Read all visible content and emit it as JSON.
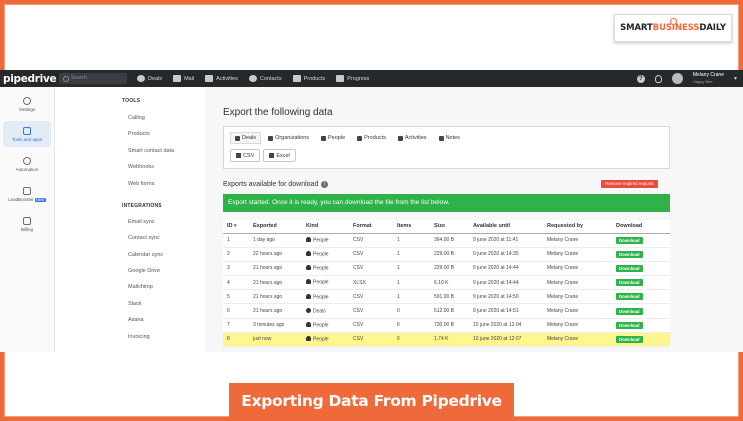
{
  "brand": {
    "smart": "SMART",
    "business": "BUSINESS",
    "daily": "DAILY"
  },
  "caption": "Exporting Data From Pipedrive",
  "topbar": {
    "logo": "pipedrive",
    "search_placeholder": "Search",
    "nav": [
      {
        "label": "Deals",
        "icon": "dollar-icon"
      },
      {
        "label": "Mail",
        "icon": "mail-icon"
      },
      {
        "label": "Activities",
        "icon": "calendar-icon"
      },
      {
        "label": "Contacts",
        "icon": "person-icon"
      },
      {
        "label": "Products",
        "icon": "box-icon"
      },
      {
        "label": "Progress",
        "icon": "trend-icon"
      }
    ],
    "user_name": "Melany Crane",
    "user_company": "Happy Bee"
  },
  "leftnav": [
    {
      "label": "Settings",
      "icon": "gear-icon"
    },
    {
      "label": "Tools and apps",
      "icon": "tools-icon",
      "active": true
    },
    {
      "label": "Automation",
      "icon": "automation-icon"
    },
    {
      "label": "LeadBooster",
      "badge": "NEW",
      "icon": "chat-icon"
    },
    {
      "label": "Billing",
      "icon": "billing-icon"
    }
  ],
  "sidenav": {
    "tools_title": "TOOLS",
    "tools": [
      "Calling",
      "Products",
      "Smart contact data",
      "Webhooks",
      "Web forms"
    ],
    "integrations_title": "INTEGRATIONS",
    "integrations": [
      "Email sync",
      "Contact sync",
      "Calendar sync",
      "Google Drive",
      "Mailchimp",
      "Slack",
      "Asana",
      "Invoicing"
    ]
  },
  "main": {
    "title": "Export the following data",
    "tabs": [
      "Deals",
      "Organizations",
      "People",
      "Products",
      "Activities",
      "Notes"
    ],
    "formats": [
      "CSV",
      "Excel"
    ],
    "exports_title": "Exports available for download",
    "remove_label": "Remove expired exports",
    "banner": "Export started. Once it is ready, you can download the file from the list below.",
    "columns": [
      "ID",
      "Exported",
      "Kind",
      "Format",
      "Items",
      "Size",
      "Available until",
      "Requested by",
      "Download"
    ],
    "rows": [
      {
        "id": "1",
        "exported": "1 day ago",
        "kind": "People",
        "format": "CSV",
        "items": "1",
        "size": "364.00 B",
        "until": "9 june 2020 at 11:41",
        "by": "Melany Crane",
        "dl": "Download"
      },
      {
        "id": "2",
        "exported": "22 hours ago",
        "kind": "People",
        "format": "CSV",
        "items": "1",
        "size": "229.00 B",
        "until": "9 june 2020 at 14:35",
        "by": "Melany Crane",
        "dl": "Download"
      },
      {
        "id": "3",
        "exported": "21 hours ago",
        "kind": "People",
        "format": "CSV",
        "items": "1",
        "size": "229.00 B",
        "until": "9 june 2020 at 14:44",
        "by": "Melany Crane",
        "dl": "Download"
      },
      {
        "id": "4",
        "exported": "21 hours ago",
        "kind": "People",
        "format": "XLSX",
        "items": "1",
        "size": "6.10 K",
        "until": "9 june 2020 at 14:44",
        "by": "Melany Crane",
        "dl": "Download"
      },
      {
        "id": "5",
        "exported": "21 hours ago",
        "kind": "People",
        "format": "CSV",
        "items": "1",
        "size": "591.00 B",
        "until": "9 june 2020 at 14:50",
        "by": "Melany Crane",
        "dl": "Download"
      },
      {
        "id": "6",
        "exported": "21 hours ago",
        "kind": "Deals",
        "format": "CSV",
        "items": "0",
        "size": "512.00 B",
        "until": "9 june 2020 at 14:51",
        "by": "Melany Crane",
        "dl": "Download"
      },
      {
        "id": "7",
        "exported": "3 minutes ago",
        "kind": "People",
        "format": "CSV",
        "items": "6",
        "size": "730.00 B",
        "until": "10 june 2020 at 12:04",
        "by": "Melany Crane",
        "dl": "Download"
      },
      {
        "id": "8",
        "exported": "just now",
        "kind": "People",
        "format": "CSV",
        "items": "6",
        "size": "1.74 K",
        "until": "10 june 2020 at 12:07",
        "by": "Melany Crane",
        "dl": "Download",
        "highlight": true
      }
    ]
  }
}
